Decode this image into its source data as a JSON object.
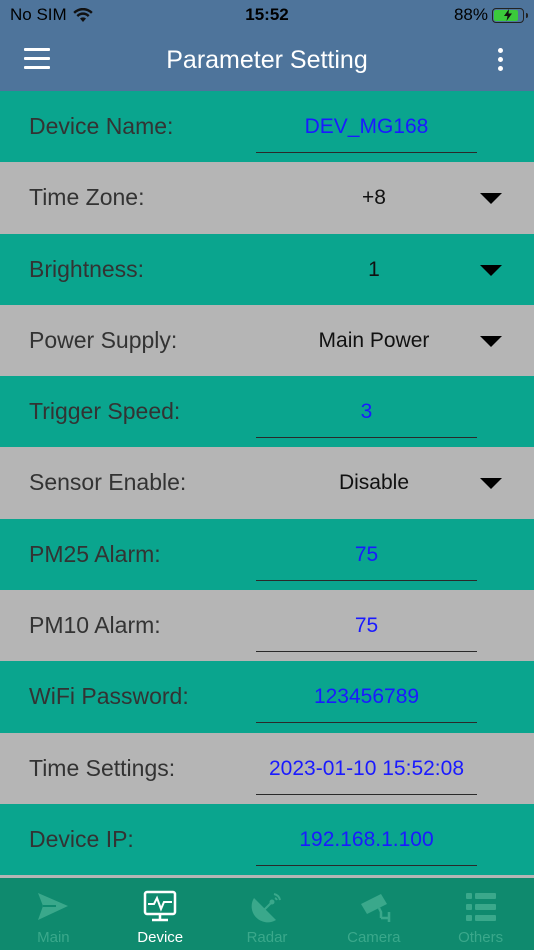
{
  "status_bar": {
    "carrier": "No SIM",
    "time": "15:52",
    "battery_percent": "88%",
    "battery_level": 0.88
  },
  "header": {
    "title": "Parameter Setting",
    "menu_icon": "hamburger-icon",
    "more_icon": "more-vertical-icon"
  },
  "rows": [
    {
      "label": "Device Name:",
      "value": "DEV_MG168",
      "kind": "input"
    },
    {
      "label": "Time Zone:",
      "value": "+8",
      "kind": "select"
    },
    {
      "label": "Brightness:",
      "value": "1",
      "kind": "select"
    },
    {
      "label": "Power Supply:",
      "value": "Main Power",
      "kind": "select"
    },
    {
      "label": "Trigger Speed:",
      "value": "3",
      "kind": "input"
    },
    {
      "label": "Sensor Enable:",
      "value": "Disable",
      "kind": "select"
    },
    {
      "label": "PM25 Alarm:",
      "value": "75",
      "kind": "input"
    },
    {
      "label": "PM10 Alarm:",
      "value": "75",
      "kind": "input"
    },
    {
      "label": "WiFi Password:",
      "value": "123456789",
      "kind": "input"
    },
    {
      "label": "Time Settings:",
      "value": "2023-01-10 15:52:08",
      "kind": "input"
    },
    {
      "label": "Device IP:",
      "value": "192.168.1.100",
      "kind": "input"
    }
  ],
  "tabs": [
    {
      "label": "Main",
      "icon": "send-icon",
      "active": false
    },
    {
      "label": "Device",
      "icon": "monitor-pulse-icon",
      "active": true
    },
    {
      "label": "Radar",
      "icon": "satellite-dish-icon",
      "active": false
    },
    {
      "label": "Camera",
      "icon": "cctv-camera-icon",
      "active": false
    },
    {
      "label": "Others",
      "icon": "list-icon",
      "active": false
    }
  ],
  "colors": {
    "header_bg": "#4e749b",
    "row_teal": "#0aa58e",
    "row_gray": "#b5b5b5",
    "value_blue": "#1a1aff",
    "tabbar_bg": "#0f8a6e",
    "tab_inactive": "#3aa88b",
    "tab_active": "#ffffff"
  }
}
